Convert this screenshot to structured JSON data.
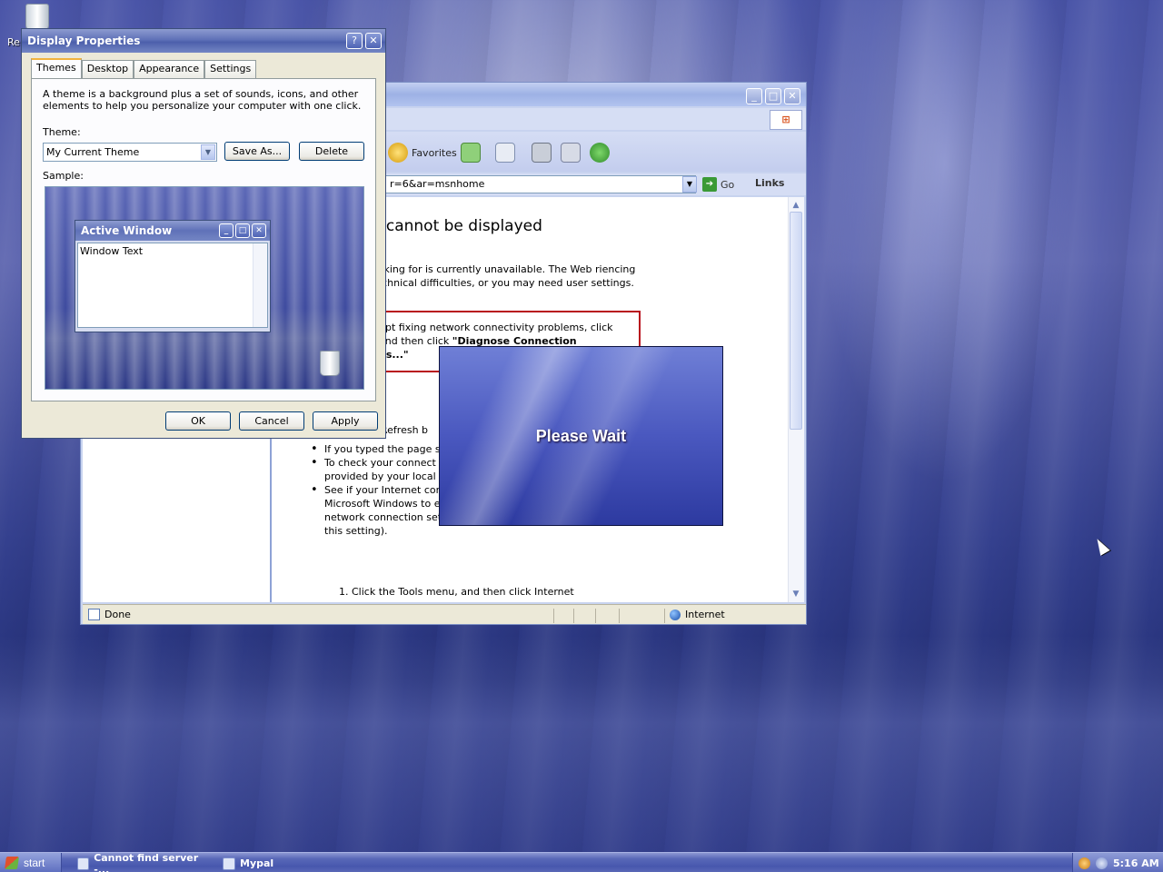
{
  "desktop": {
    "recycle_bin_label": "Re",
    "cursor_icon": "arrow-cursor"
  },
  "ie_window": {
    "address": "r=6&ar=msnhome",
    "toolbar": {
      "favorites_label": "Favorites"
    },
    "go_label": "Go",
    "links_label": "Links",
    "content": {
      "title": "e cannot be displayed",
      "para1": "ooking for is currently unavailable. The Web riencing technical difficulties, or you may need user settings.",
      "red_box_line1": "npt fixing network connectivity problems, click",
      "red_box_line2": "and then click ",
      "red_box_bold2": "\"Diagnose Connection",
      "red_box_line3": "ns...\"",
      "try_label": "r:",
      "refresh_text": "Refresh b",
      "bullets": [
        "If you typed the page sure that it is spelled c",
        "To check your connect and then click Interne tab, click Settings. Th provided by your local Internet service provider (ISP).",
        "See if your Internet connection settings are being detected. You can set Microsoft Windows to examine your network and automatically discover network connection settings (if your network administrator has enabled this setting)."
      ],
      "sub_step": "1.  Click the Tools menu, and then click Internet"
    },
    "status": {
      "left": "Done",
      "zone": "Internet"
    }
  },
  "please_wait": {
    "text": "Please Wait"
  },
  "display_properties": {
    "title": "Display Properties",
    "help_button": "?",
    "close_button": "✕",
    "tabs": [
      "Themes",
      "Desktop",
      "Appearance",
      "Settings"
    ],
    "active_tab": "Themes",
    "description": "A theme is a background plus a set of sounds, icons, and other elements to help you personalize your computer with one click.",
    "theme_label": "Theme:",
    "theme_value": "My Current Theme",
    "save_as": "Save As...",
    "delete": "Delete",
    "sample_label": "Sample:",
    "sample_window_title": "Active Window",
    "sample_window_text": "Window Text",
    "ok": "OK",
    "cancel": "Cancel",
    "apply": "Apply"
  },
  "taskbar": {
    "start": "start",
    "tasks": [
      "Cannot find server -...",
      "Mypal"
    ],
    "clock": "5:16 AM"
  }
}
